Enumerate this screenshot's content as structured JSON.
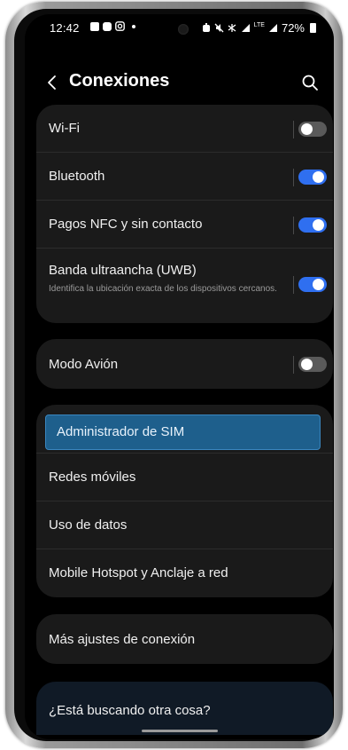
{
  "status_bar": {
    "time": "12:42",
    "left_icons": [
      "gallery-icon",
      "message-icon",
      "instagram-icon",
      "dot-icon"
    ],
    "right_icons": [
      "alarm-icon",
      "mute-icon",
      "bluetooth-icon",
      "signal-icon",
      "lte-signal-icon"
    ],
    "lte_label": "LTE",
    "battery": "72%"
  },
  "header": {
    "title": "Conexiones"
  },
  "group1": [
    {
      "label": "Wi-Fi",
      "toggle": "off"
    },
    {
      "label": "Bluetooth",
      "toggle": "on"
    },
    {
      "label": "Pagos NFC y sin contacto",
      "toggle": "on"
    },
    {
      "label": "Banda ultraancha (UWB)",
      "sub": "Identifica la ubicación exacta de los dispositivos cercanos.",
      "toggle": "on"
    }
  ],
  "group2": [
    {
      "label": "Modo Avión",
      "toggle": "off"
    }
  ],
  "group3": [
    {
      "label": "Administrador de SIM",
      "highlighted": true
    },
    {
      "label": "Redes móviles"
    },
    {
      "label": "Uso de datos"
    },
    {
      "label": "Mobile Hotspot y Anclaje a red"
    }
  ],
  "group4": [
    {
      "label": "Más ajustes de conexión"
    }
  ],
  "search_suggest": {
    "label": "¿Está buscando otra cosa?"
  },
  "colors": {
    "toggle_on": "#2f6ff0",
    "toggle_off": "#5a5a5a",
    "highlight": "#1e5f8c",
    "card": "#1a1a1a",
    "background": "#000000"
  }
}
